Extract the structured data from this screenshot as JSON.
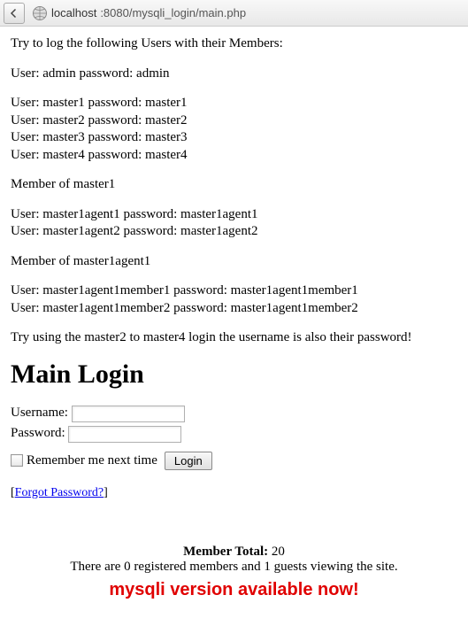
{
  "browser": {
    "url_host": "localhost",
    "url_rest": ":8080/mysqli_login/main.php"
  },
  "intro": "Try to log the following Users with their Members:",
  "admin_line": "User: admin password: admin",
  "masters": [
    "User: master1 password: master1",
    "User: master2 password: master2",
    "User: master3 password: master3",
    "User: master4 password: master4"
  ],
  "member_of_master1": "Member of master1",
  "master1agents": [
    "User: master1agent1 password: master1agent1",
    "User: master1agent2 password: master1agent2"
  ],
  "member_of_agent1": "Member of master1agent1",
  "agent1members": [
    "User: master1agent1member1 password: master1agent1member1",
    "User: master1agent1member2 password: master1agent1member2"
  ],
  "try_hint": "Try using the master2 to master4 login the username is also their password!",
  "heading": "Main Login",
  "form": {
    "username_label": "Username:",
    "password_label": "Password:",
    "remember_label": "Remember me next time",
    "login_button": "Login"
  },
  "forgot": {
    "open": "[",
    "link": "Forgot Password?",
    "close": "]"
  },
  "stats": {
    "label": "Member Total:",
    "total": "20",
    "line2": "There are 0 registered members and 1 guests viewing the site."
  },
  "banner": "mysqli version available now!"
}
